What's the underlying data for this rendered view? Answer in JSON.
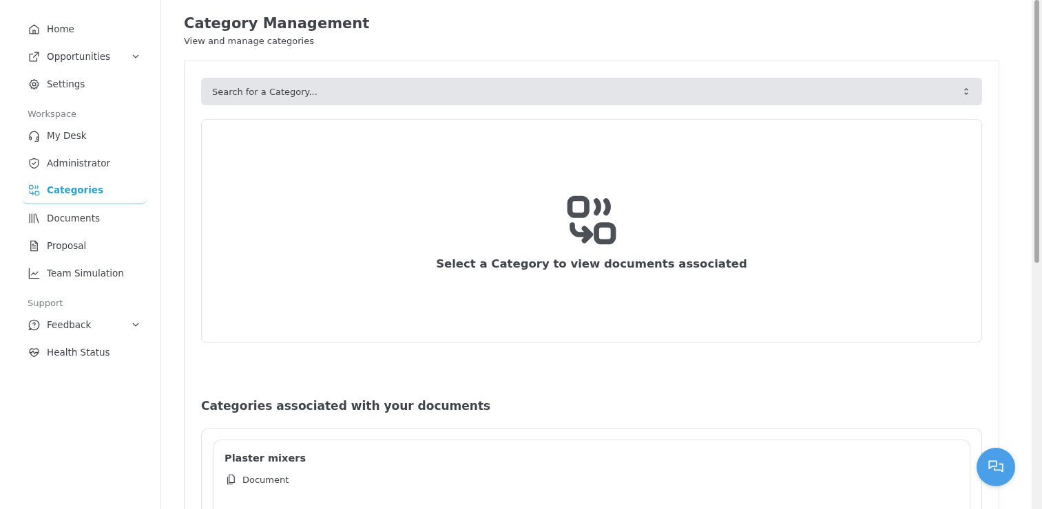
{
  "sidebar": {
    "groups": [
      {
        "items": [
          {
            "label": "Home",
            "selected": false,
            "expandable": false
          },
          {
            "label": "Opportunities",
            "selected": false,
            "expandable": true
          },
          {
            "label": "Settings",
            "selected": false,
            "expandable": false
          }
        ]
      },
      {
        "heading": "Workspace",
        "items": [
          {
            "label": "My Desk",
            "selected": false,
            "expandable": false
          },
          {
            "label": "Administrator",
            "selected": false,
            "expandable": false
          },
          {
            "label": "Categories",
            "selected": true,
            "expandable": false
          },
          {
            "label": "Documents",
            "selected": false,
            "expandable": false
          },
          {
            "label": "Proposal",
            "selected": false,
            "expandable": false
          },
          {
            "label": "Team Simulation",
            "selected": false,
            "expandable": false
          }
        ]
      },
      {
        "heading": "Support",
        "items": [
          {
            "label": "Feedback",
            "selected": false,
            "expandable": true
          },
          {
            "label": "Health Status",
            "selected": false,
            "expandable": false
          }
        ]
      }
    ]
  },
  "page": {
    "title": "Category Management",
    "subtitle": "View and manage categories"
  },
  "search": {
    "placeholder": "Search for a Category..."
  },
  "empty_state": {
    "message": "Select a Category to view documents associated"
  },
  "categories_section": {
    "heading": "Categories associated with your documents",
    "categories": [
      {
        "name": "Plaster mixers",
        "documents": [
          {
            "label": "Document"
          }
        ]
      }
    ]
  }
}
